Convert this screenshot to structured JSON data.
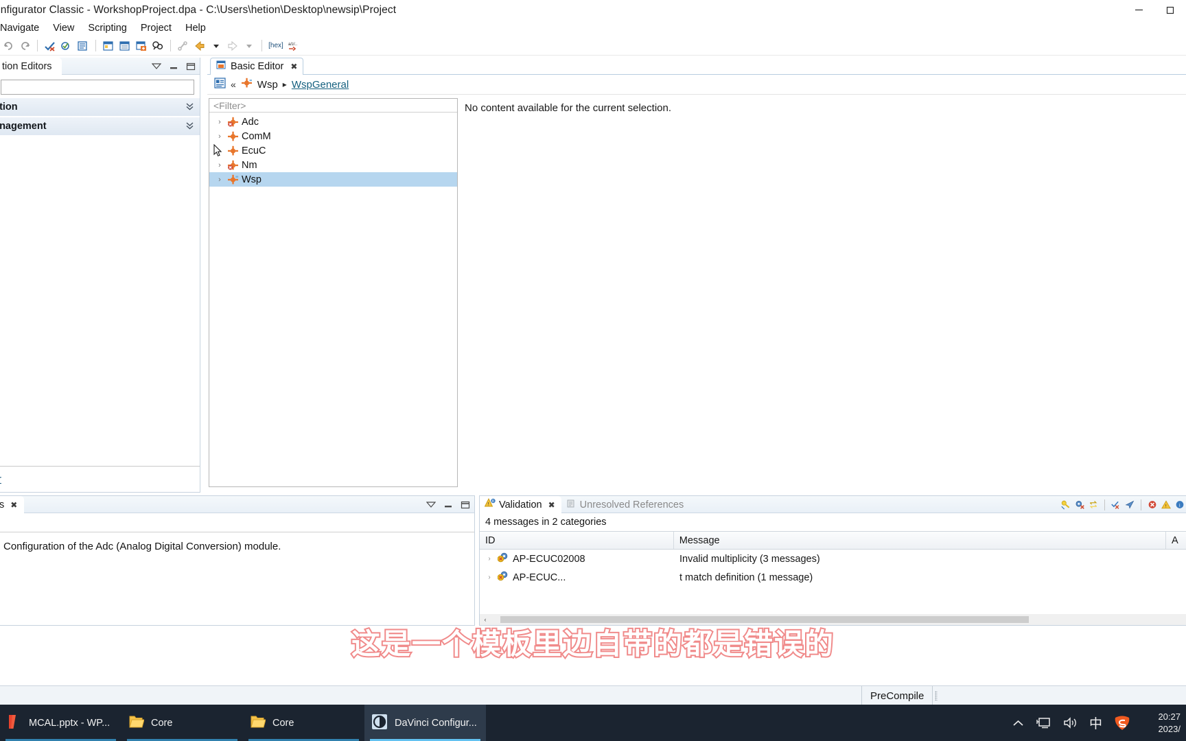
{
  "window": {
    "title": "onfigurator Classic - WorkshopProject.dpa - C:\\Users\\hetion\\Desktop\\newsip\\Project",
    "minimize_label": "Minimize",
    "restore_label": "Restore"
  },
  "menubar": {
    "items": [
      {
        "label": "Navigate",
        "name": "menu-navigate"
      },
      {
        "label": "View",
        "name": "menu-view"
      },
      {
        "label": "Scripting",
        "name": "menu-scripting"
      },
      {
        "label": "Project",
        "name": "menu-project"
      },
      {
        "label": "Help",
        "name": "menu-help"
      }
    ]
  },
  "toolbar": {
    "buttons": [
      {
        "name": "undo-button",
        "glyph": "↶"
      },
      {
        "name": "redo-button",
        "glyph": "↷"
      },
      {
        "name": "validate-button",
        "glyph": "✓"
      },
      {
        "name": "validate-all-button",
        "glyph": "✔"
      },
      {
        "name": "generate-button",
        "glyph": "≡"
      },
      {
        "name": "new-editor-button",
        "glyph": "▤"
      },
      {
        "name": "basic-editor-button",
        "glyph": "▥"
      },
      {
        "name": "add-module-button",
        "glyph": "▦"
      },
      {
        "name": "search-button",
        "glyph": "🔍"
      },
      {
        "name": "link-button",
        "glyph": "⚓"
      },
      {
        "name": "back-button",
        "glyph": "←"
      },
      {
        "name": "back-dropdown-button",
        "glyph": "▾"
      },
      {
        "name": "forward-button",
        "glyph": "→"
      },
      {
        "name": "forward-dropdown-button",
        "glyph": "▾"
      },
      {
        "name": "hex-button",
        "glyph": "[hex]"
      },
      {
        "name": "abc-button",
        "glyph": "a/z"
      }
    ]
  },
  "left_view": {
    "tab_label": "tion Editors",
    "tools": [
      {
        "name": "view-menu-icon",
        "glyph": "▽"
      },
      {
        "name": "minimize-view-icon",
        "glyph": "−"
      },
      {
        "name": "maximize-view-icon",
        "glyph": "☐"
      }
    ],
    "filter_placeholder": "",
    "filter_value": "",
    "sections": [
      {
        "label": "ation",
        "name": "section-configuration"
      },
      {
        "label": "anagement",
        "name": "section-management"
      }
    ],
    "link_label": "tor"
  },
  "editor": {
    "tab_label": "Basic Editor",
    "tab_close": "✖",
    "breadcrumb": {
      "home_icon": "editor-home-icon",
      "double_left": "«",
      "root": "Wsp",
      "separator": "▸",
      "current": "WspGeneral"
    },
    "tree": {
      "filter_text": "<Filter>",
      "rows": [
        {
          "label": "Adc",
          "twisty": "›",
          "error": true,
          "selected": false
        },
        {
          "label": "ComM",
          "twisty": "›",
          "error": false,
          "selected": false
        },
        {
          "label": "EcuC",
          "twisty": "›",
          "error": false,
          "selected": false
        },
        {
          "label": "Nm",
          "twisty": "›",
          "error": true,
          "selected": false
        },
        {
          "label": "Wsp",
          "twisty": "›",
          "error": false,
          "selected": true
        }
      ]
    },
    "no_content_message": "No content available for the current selection."
  },
  "description_view": {
    "tab_label": "s",
    "tab_close": "✖",
    "tools": [
      {
        "name": "view-menu-icon",
        "glyph": "▽"
      },
      {
        "name": "minimize-view-icon",
        "glyph": "−"
      },
      {
        "name": "maximize-view-icon",
        "glyph": "☐"
      }
    ],
    "text": "Configuration of the Adc (Analog Digital Conversion) module."
  },
  "validation": {
    "tabs": [
      {
        "label": "Validation",
        "name": "tab-validation",
        "active": true,
        "close": "✖"
      },
      {
        "label": "Unresolved References",
        "name": "tab-unresolved-references",
        "active": false
      }
    ],
    "tools": [
      {
        "name": "solve-issue-icon",
        "glyph": "⚒"
      },
      {
        "name": "remove-solution-icon",
        "glyph": "⚙"
      },
      {
        "name": "toggle-grouping-icon",
        "glyph": "⇄"
      },
      {
        "name": "clear-icon",
        "glyph": "✘"
      },
      {
        "name": "filter-icon",
        "glyph": "➤"
      },
      {
        "name": "errors-icon",
        "glyph": "✖"
      },
      {
        "name": "warnings-icon",
        "glyph": "⚠"
      },
      {
        "name": "info-icon",
        "glyph": "ℹ"
      }
    ],
    "summary": "4 messages in 2 categories",
    "columns": [
      "ID",
      "Message",
      "A"
    ],
    "rows": [
      {
        "id": "AP-ECUC02008",
        "message": "Invalid multiplicity (3 messages)",
        "twisty": "›"
      },
      {
        "id": "AP-ECUC...",
        "message": "t match definition (1 message)",
        "twisty": "›"
      }
    ],
    "hscroll": {
      "left_arrow": "‹",
      "right_arrow": "›"
    }
  },
  "statusbar": {
    "precompile_label": "PreCompile"
  },
  "overlay": {
    "subtitle": "这是一个模板里边自带的都是错误的"
  },
  "taskbar": {
    "items": [
      {
        "label": "MCAL.pptx - WP...",
        "name": "taskbar-item-mcal-pptx",
        "icon": "wps-powerpoint-icon",
        "active": false
      },
      {
        "label": "Core",
        "name": "taskbar-item-core-1",
        "icon": "folder-icon",
        "active": false
      },
      {
        "label": "Core",
        "name": "taskbar-item-core-2",
        "icon": "folder-icon",
        "active": false
      },
      {
        "label": "DaVinci Configur...",
        "name": "taskbar-item-davinci",
        "icon": "davinci-icon",
        "active": true
      }
    ],
    "tray": [
      {
        "name": "show-hidden-icons-icon",
        "glyph": "∧"
      },
      {
        "name": "network-icon",
        "glyph": "🖥"
      },
      {
        "name": "volume-icon",
        "glyph": "🔊"
      },
      {
        "name": "ime-chinese-icon",
        "glyph": "中"
      },
      {
        "name": "sogou-input-icon",
        "glyph": "S"
      }
    ],
    "clock": {
      "time": "20:27",
      "date": "2023/"
    }
  },
  "colors": {
    "accent": "#3aa0d8",
    "link": "#15607f",
    "selection": "#b6d6ef",
    "taskbar_bg": "#1b2430",
    "overlay_stroke": "#f08a8a",
    "module_icon": "#e8762c",
    "error": "#d14836",
    "warning": "#e8b10a"
  }
}
